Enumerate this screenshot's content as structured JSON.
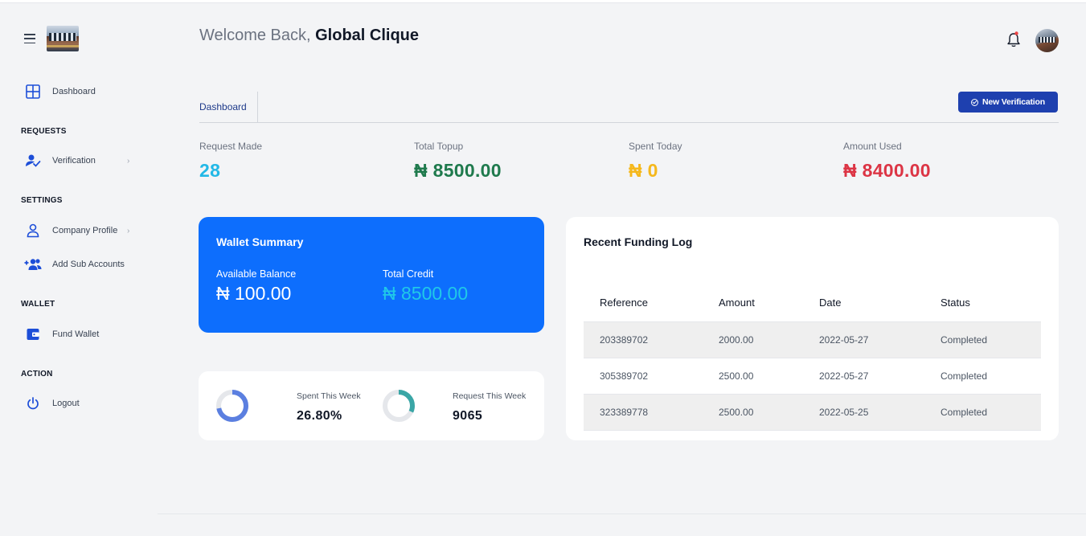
{
  "header": {
    "welcome_prefix": "Welcome Back, ",
    "user_name": "Global Clique"
  },
  "sidebar": {
    "sections": {
      "requests": "REQUESTS",
      "settings": "SETTINGS",
      "wallet": "WALLET",
      "action": "ACTION"
    },
    "items": [
      {
        "label": "Dashboard",
        "icon": "grid-icon"
      },
      {
        "label": "Verification",
        "icon": "user-check-icon"
      },
      {
        "label": "Company Profile",
        "icon": "user-icon"
      },
      {
        "label": "Add Sub Accounts",
        "icon": "users-plus-icon"
      },
      {
        "label": "Fund Wallet",
        "icon": "wallet-icon"
      },
      {
        "label": "Logout",
        "icon": "power-icon"
      }
    ]
  },
  "tabs": {
    "active": "Dashboard"
  },
  "actions": {
    "new_verification": "New Verification"
  },
  "stats": [
    {
      "label": "Request Made",
      "value": "28",
      "color": "#22b8e6"
    },
    {
      "label": "Total Topup",
      "value": "₦ 8500.00",
      "color": "#1f7a4d"
    },
    {
      "label": "Spent Today",
      "value": "₦ 0",
      "color": "#f5b81c"
    },
    {
      "label": "Amount Used",
      "value": "₦ 8400.00",
      "color": "#dc3545"
    }
  ],
  "wallet_summary": {
    "title": "Wallet Summary",
    "available_label": "Available Balance",
    "available_value": "₦ 100.00",
    "credit_label": "Total Credit",
    "credit_value": "₦ 8500.00"
  },
  "weekly": {
    "spent_label": "Spent This Week",
    "spent_value": "26.80%",
    "spent_fraction": 0.72,
    "request_label": "Request This Week",
    "request_value": "9065",
    "request_fraction": 0.32
  },
  "funding_log": {
    "title": "Recent Funding Log",
    "columns": [
      "Reference",
      "Amount",
      "Date",
      "Status"
    ],
    "rows": [
      [
        "203389702",
        "2000.00",
        "2022-05-27",
        "Completed"
      ],
      [
        "305389702",
        "2500.00",
        "2022-05-27",
        "Completed"
      ],
      [
        "323389778",
        "2500.00",
        "2022-05-25",
        "Completed"
      ]
    ]
  },
  "colors": {
    "primary": "#0d6efd",
    "button": "#1e40af",
    "credit": "#20c9e8",
    "donut_blue": "#5b7fe0",
    "donut_teal": "#3aa6a6"
  }
}
